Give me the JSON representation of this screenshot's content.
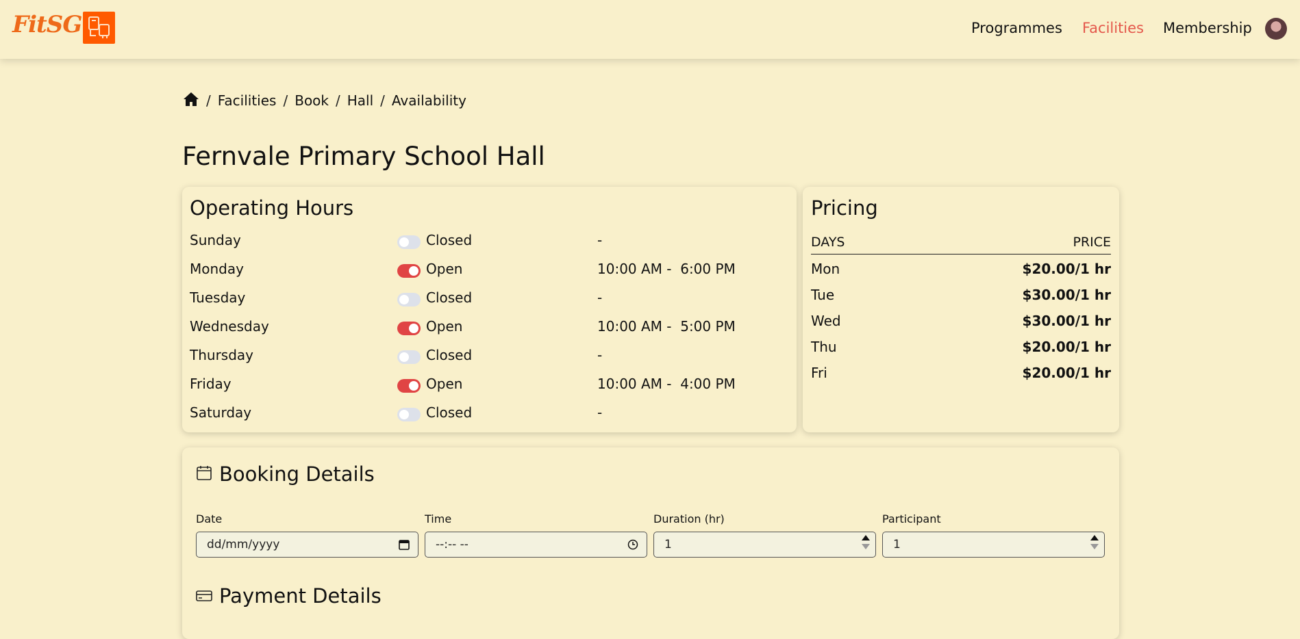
{
  "header": {
    "logo_text": "FitSG",
    "nav": [
      {
        "label": "Programmes"
      },
      {
        "label": "Facilities"
      },
      {
        "label": "Membership"
      }
    ]
  },
  "breadcrumb": [
    "Facilities",
    "Book",
    "Hall",
    "Availability"
  ],
  "page_title": "Fernvale Primary School Hall",
  "operating_hours": {
    "title": "Operating Hours",
    "days": [
      {
        "day": "Sunday",
        "status": "Closed",
        "hours": "-"
      },
      {
        "day": "Monday",
        "status": "Open",
        "hours": "10:00 AM -  6:00 PM"
      },
      {
        "day": "Tuesday",
        "status": "Closed",
        "hours": "-"
      },
      {
        "day": "Wednesday",
        "status": "Open",
        "hours": "10:00 AM -  5:00 PM"
      },
      {
        "day": "Thursday",
        "status": "Closed",
        "hours": "-"
      },
      {
        "day": "Friday",
        "status": "Open",
        "hours": "10:00 AM -  4:00 PM"
      },
      {
        "day": "Saturday",
        "status": "Closed",
        "hours": "-"
      }
    ]
  },
  "pricing": {
    "title": "Pricing",
    "col_days": "DAYS",
    "col_price": "PRICE",
    "rows": [
      {
        "day": "Mon",
        "price": "$20.00/1 hr"
      },
      {
        "day": "Tue",
        "price": "$30.00/1 hr"
      },
      {
        "day": "Wed",
        "price": "$30.00/1 hr"
      },
      {
        "day": "Thu",
        "price": "$20.00/1 hr"
      },
      {
        "day": "Fri",
        "price": "$20.00/1 hr"
      }
    ]
  },
  "booking": {
    "title": "Booking Details",
    "date_label": "Date",
    "date_placeholder": "dd/mm/yyyy",
    "time_label": "Time",
    "time_placeholder": "--:-- --",
    "duration_label": "Duration (hr)",
    "duration_value": "1",
    "participant_label": "Participant",
    "participant_value": "1"
  },
  "payment": {
    "title": "Payment Details"
  },
  "colors": {
    "background": "#f9f0cb",
    "accent": "#e4574b",
    "toggle_on": "#e04444",
    "logo_orange": "#ff5a00"
  }
}
